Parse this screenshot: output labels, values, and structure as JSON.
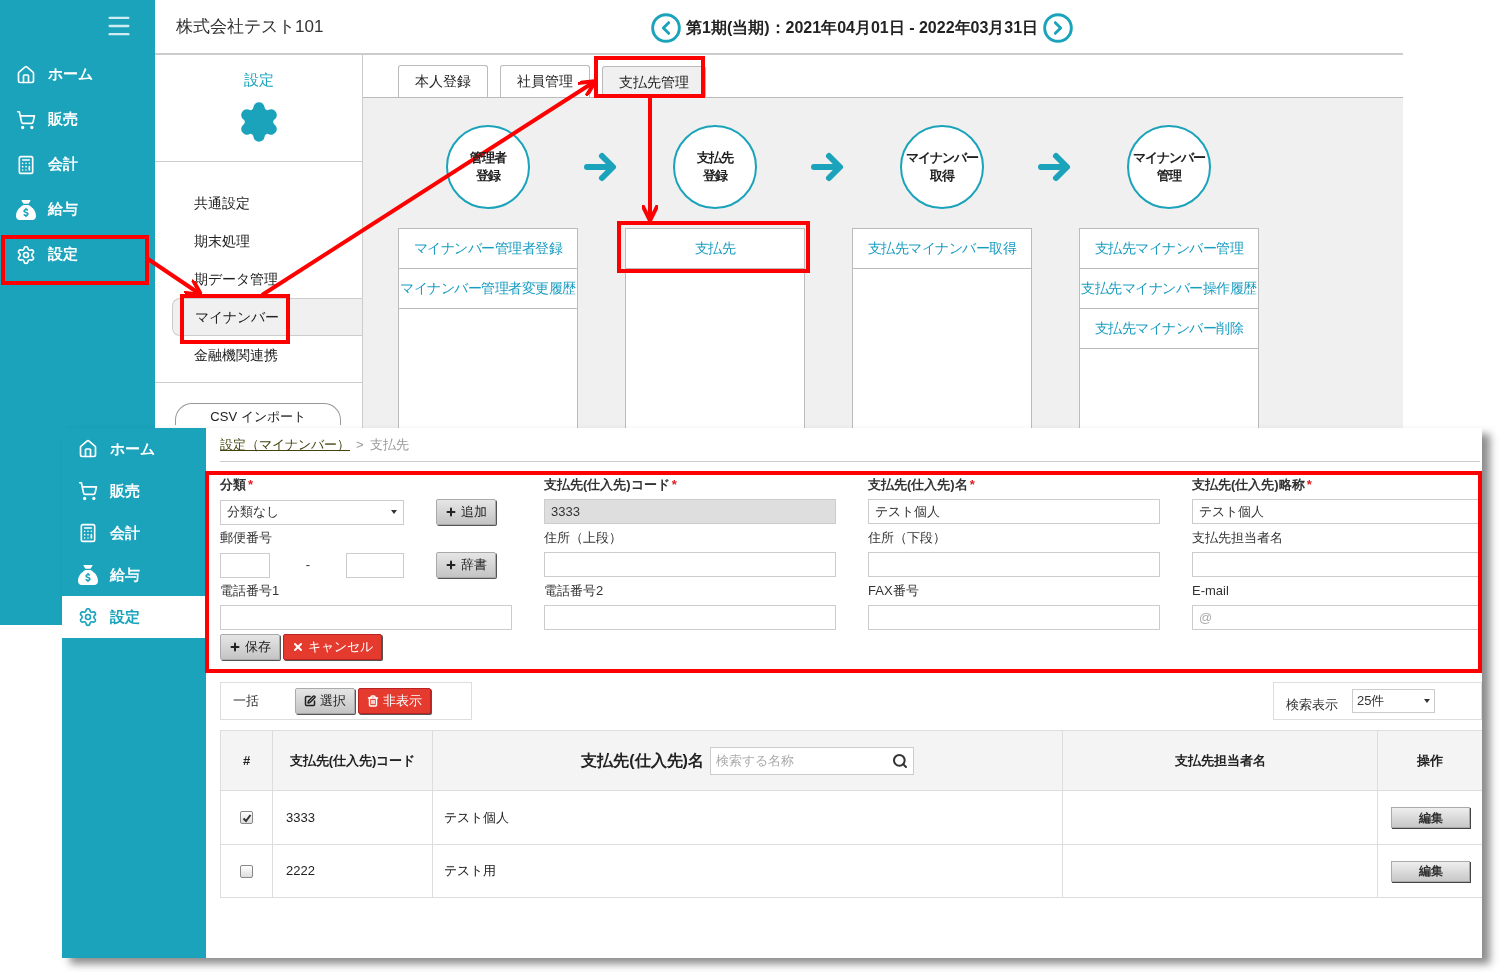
{
  "back_screen": {
    "sidebar": [
      {
        "label": "ホーム",
        "selected": false
      },
      {
        "label": "販売",
        "selected": false
      },
      {
        "label": "会計",
        "selected": false
      },
      {
        "label": "給与",
        "selected": false
      },
      {
        "label": "設定",
        "selected": false
      }
    ],
    "company": "株式会社テスト101",
    "period": "第1期(当期)：2021年04月01日 - 2022年03月31日",
    "settings_panel": {
      "title": "設定",
      "items": [
        {
          "label": "共通設定",
          "selected": false
        },
        {
          "label": "期末処理",
          "selected": false
        },
        {
          "label": "期データ管理",
          "selected": false
        },
        {
          "label": "マイナンバー",
          "selected": true
        },
        {
          "label": "金融機関連携",
          "selected": false
        }
      ],
      "csv_button": "CSV インポート"
    },
    "tabs": [
      {
        "label": "本人登録",
        "selected": false
      },
      {
        "label": "社員管理",
        "selected": false
      },
      {
        "label": "支払先管理",
        "selected": true
      }
    ],
    "steps": [
      {
        "lines": [
          "管理者",
          "登録"
        ],
        "links": [
          "マイナンバー管理者登録",
          "マイナンバー管理者変更履歴"
        ]
      },
      {
        "lines": [
          "支払先",
          "登録"
        ],
        "links": [
          "支払先"
        ]
      },
      {
        "lines": [
          "マイナンバー",
          "取得"
        ],
        "links": [
          "支払先マイナンバー取得"
        ]
      },
      {
        "lines": [
          "マイナンバー",
          "管理"
        ],
        "links": [
          "支払先マイナンバー管理",
          "支払先マイナンバー操作履歴",
          "支払先マイナンバー削除"
        ]
      }
    ]
  },
  "front_screen": {
    "sidebar": [
      {
        "label": "ホーム",
        "selected": false
      },
      {
        "label": "販売",
        "selected": false
      },
      {
        "label": "会計",
        "selected": false
      },
      {
        "label": "給与",
        "selected": false
      },
      {
        "label": "設定",
        "selected": true
      }
    ],
    "breadcrumb": {
      "link": "設定（マイナンバー）",
      "separator": ">",
      "current": "支払先"
    },
    "form": {
      "fields": [
        {
          "kind": "select",
          "label": "分類",
          "mark": "*",
          "value": "分類なし",
          "disabled": false,
          "button": "追加"
        },
        {
          "kind": "text",
          "label": "支払先(仕入先)コード",
          "mark": "*",
          "value": "3333",
          "disabled": true
        },
        {
          "kind": "text",
          "label": "支払先(仕入先)名",
          "mark": "*",
          "value": "テスト個人",
          "disabled": false
        },
        {
          "kind": "text",
          "label": "支払先(仕入先)略称",
          "mark": "*",
          "value": "テスト個人",
          "disabled": false
        },
        {
          "kind": "postal",
          "label": "郵便番号",
          "separator": "-",
          "disabled": false,
          "button": "辞書"
        },
        {
          "kind": "text",
          "label": "住所（上段）",
          "disabled": false
        },
        {
          "kind": "text",
          "label": "住所（下段）",
          "disabled": false
        },
        {
          "kind": "text",
          "label": "支払先担当者名",
          "disabled": false
        },
        {
          "kind": "text",
          "label": "電話番号1",
          "disabled": false
        },
        {
          "kind": "text",
          "label": "電話番号2",
          "disabled": false
        },
        {
          "kind": "text",
          "label": "FAX番号",
          "disabled": false
        },
        {
          "kind": "text",
          "label": "E-mail",
          "placeholder": "@",
          "disabled": false
        }
      ],
      "save_button": "保存",
      "cancel_button": "キャンセル"
    },
    "bulk": {
      "label": "一括",
      "select_button": "選択",
      "hide_button": "非表示"
    },
    "page_size": {
      "label": "検索表示",
      "value": "25件"
    },
    "table": {
      "columns": [
        "#",
        "支払先(仕入先)コード",
        "支払先(仕入先)名",
        "支払先担当者名",
        "操作"
      ],
      "search_placeholder": "検索する名称",
      "rows": [
        {
          "checked": true,
          "code": "3333",
          "name": "テスト個人",
          "edit": "編集"
        },
        {
          "checked": false,
          "code": "2222",
          "name": "テスト用",
          "edit": "編集"
        }
      ]
    }
  }
}
